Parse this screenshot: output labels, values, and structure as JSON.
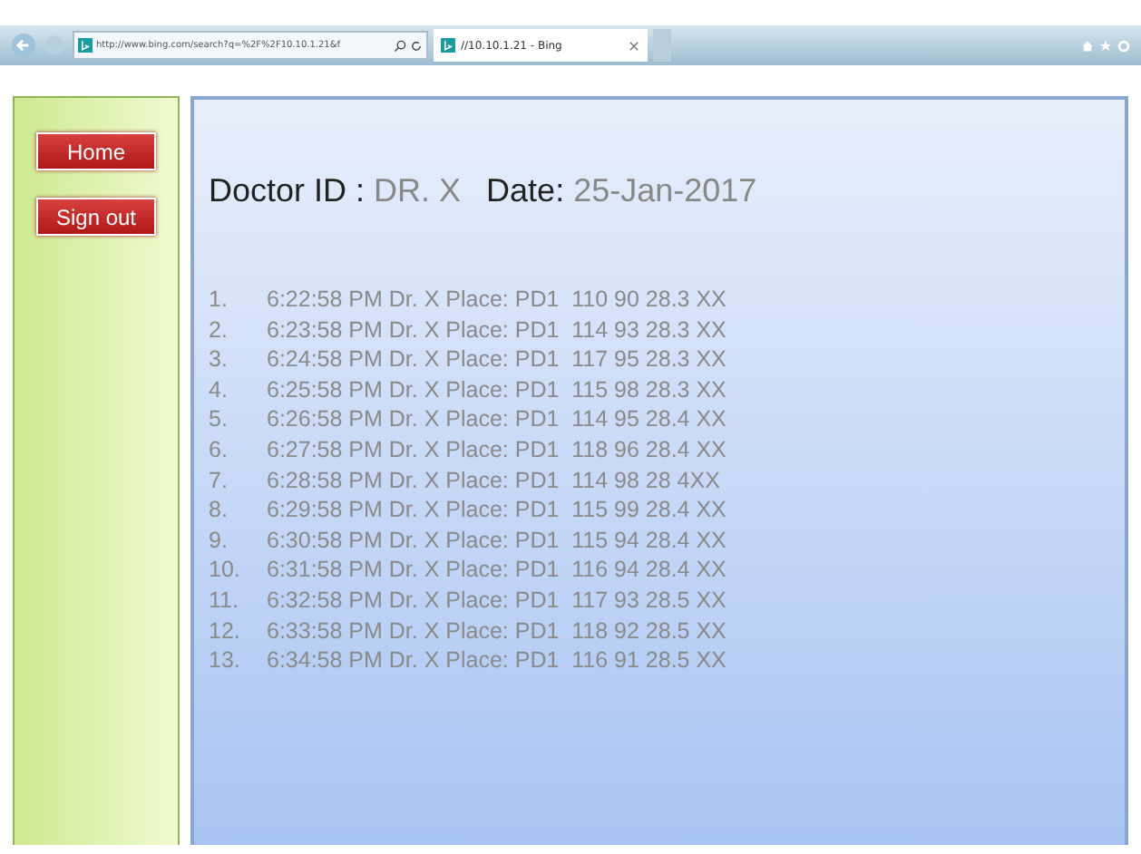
{
  "browser": {
    "address": "http://www.bing.com/search?q=%2F%2F10.10.1.21&f",
    "tab_title": "//10.10.1.21 - Bing"
  },
  "sidebar": {
    "buttons": [
      "Home",
      "Sign out"
    ]
  },
  "header": {
    "doctor_label": "Doctor ID :",
    "doctor_id": "DR. X",
    "date_label": "Date:",
    "date": "25-Jan-2017"
  },
  "records": [
    {
      "number": "1.",
      "text": "6:22:58 PM Dr. X Place: PD1  110 90 28.3 XX"
    },
    {
      "number": "2.",
      "text": "6:23:58 PM Dr. X Place: PD1  114 93 28.3 XX"
    },
    {
      "number": "3.",
      "text": "6:24:58 PM Dr. X Place: PD1  117 95 28.3 XX"
    },
    {
      "number": "4.",
      "text": "6:25:58 PM Dr. X Place: PD1  115 98 28.3 XX"
    },
    {
      "number": "5.",
      "text": "6:26:58 PM Dr. X Place: PD1  114 95 28.4 XX"
    },
    {
      "number": "6.",
      "text": "6:27:58 PM Dr. X Place: PD1  118 96 28.4 XX"
    },
    {
      "number": "7.",
      "text": "6:28:58 PM Dr. X Place: PD1  114 98 28 4XX"
    },
    {
      "number": "8.",
      "text": "6:29:58 PM Dr. X Place: PD1  115 99 28.4 XX"
    },
    {
      "number": "9.",
      "text": "6:30:58 PM Dr. X Place: PD1  115 94 28.4 XX"
    },
    {
      "number": "10.",
      "text": "6:31:58 PM Dr. X Place: PD1  116 94 28.4 XX"
    },
    {
      "number": "11.",
      "text": "6:32:58 PM Dr. X Place: PD1  117 93 28.5 XX"
    },
    {
      "number": "12.",
      "text": "6:33:58 PM Dr. X Place: PD1  118 92 28.5 XX"
    },
    {
      "number": "13.",
      "text": "6:34:58 PM Dr. X Place: PD1  116 91 28.5 XX"
    }
  ]
}
